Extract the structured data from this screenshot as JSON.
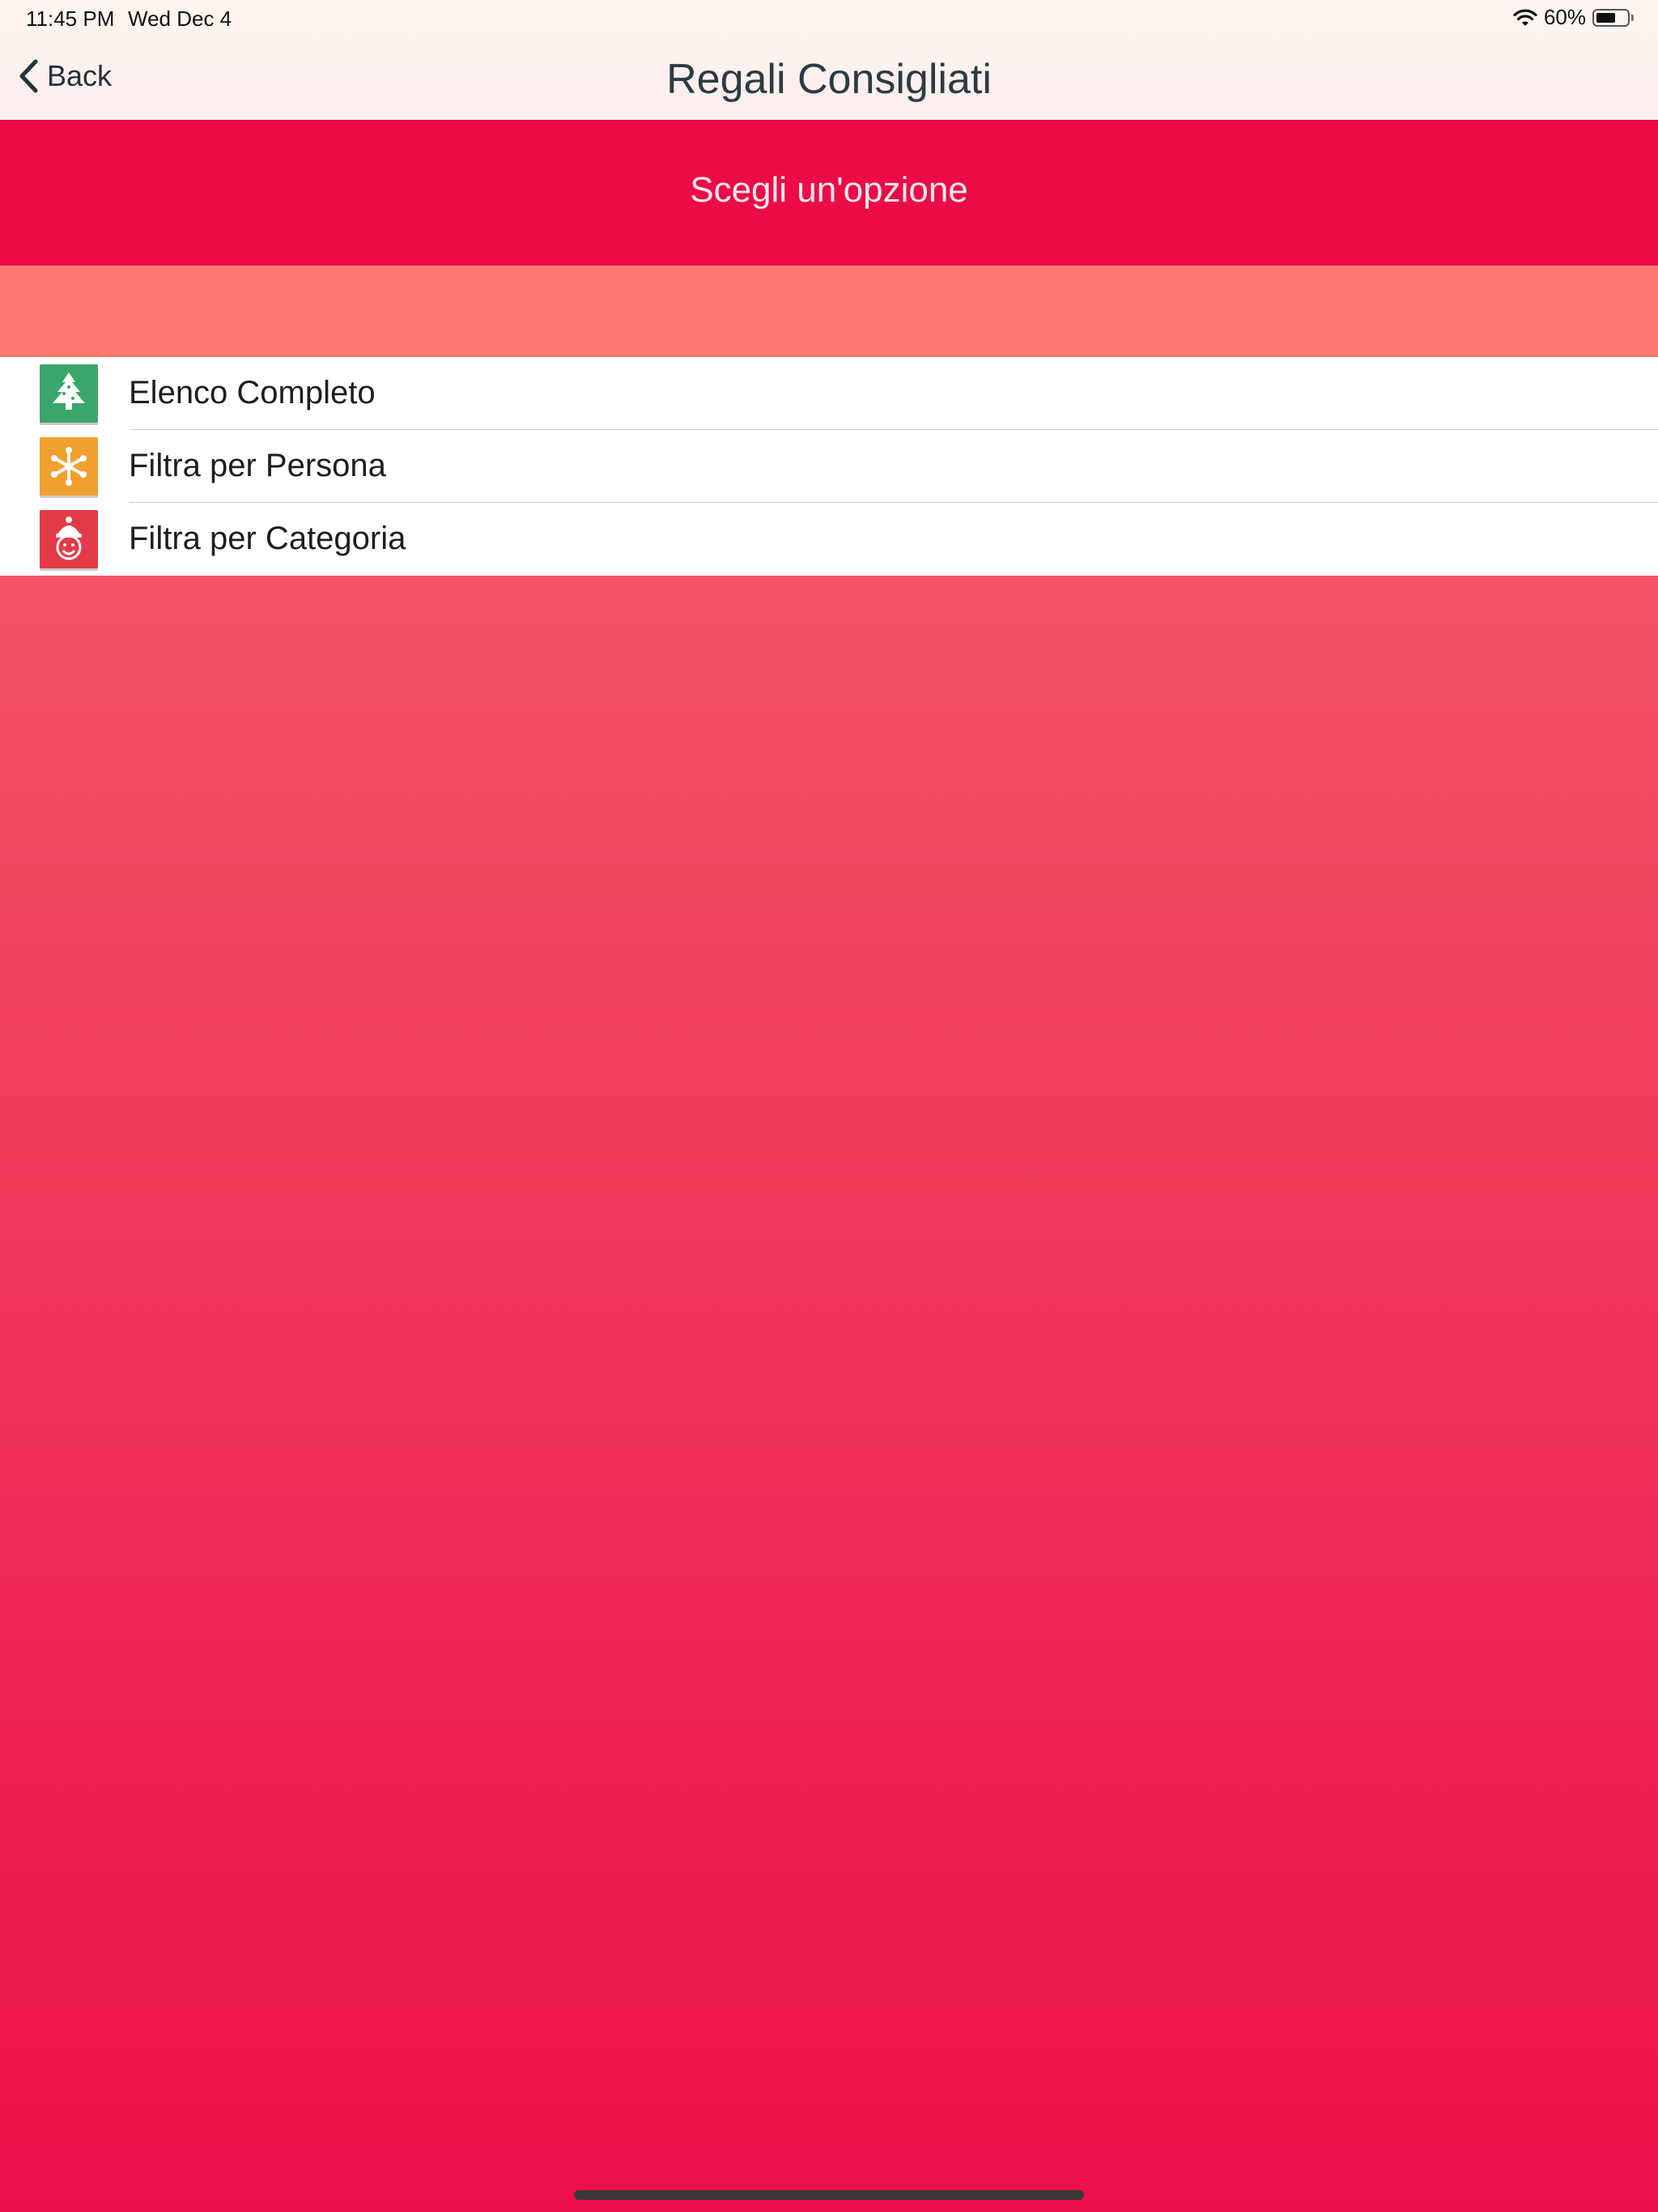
{
  "status_bar": {
    "time": "11:45 PM",
    "date": "Wed Dec 4",
    "battery_percent": "60%",
    "battery_level": 0.6
  },
  "nav": {
    "back_label": "Back",
    "title": "Regali Consigliati"
  },
  "header": {
    "prompt": "Scegli un'opzione"
  },
  "menu": {
    "items": [
      {
        "label": "Elenco Completo",
        "icon": "christmas-tree-icon",
        "color": "#3aa76a"
      },
      {
        "label": "Filtra per Persona",
        "icon": "snowflake-icon",
        "color": "#f0a030"
      },
      {
        "label": "Filtra per Categoria",
        "icon": "santa-icon",
        "color": "#e23a47"
      }
    ]
  },
  "colors": {
    "header_band": "#eb0b46",
    "spacer_band": "#ff776f",
    "background_top": "#fa6a6e",
    "background_bottom": "#ec0f4b"
  }
}
